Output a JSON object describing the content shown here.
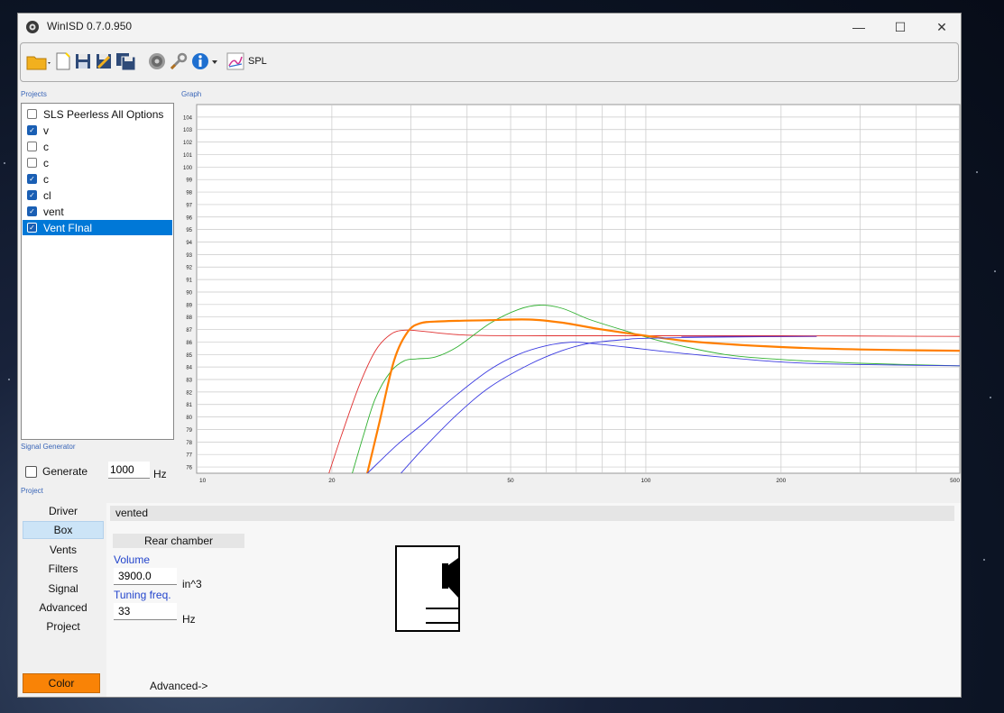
{
  "window": {
    "title": "WinISD 0.7.0.950"
  },
  "titlebar": {
    "minimize": "—",
    "maximize": "☐",
    "close": "✕"
  },
  "toolbar": {
    "spl_label": "SPL"
  },
  "groups": {
    "projects": "Projects",
    "graph": "Graph",
    "signal_generator": "Signal Generator",
    "project": "Project"
  },
  "projects": [
    {
      "name": "SLS Peerless All Options",
      "checked": false
    },
    {
      "name": "v",
      "checked": true
    },
    {
      "name": "c",
      "checked": false
    },
    {
      "name": "c",
      "checked": false
    },
    {
      "name": "c",
      "checked": true
    },
    {
      "name": "cl",
      "checked": true
    },
    {
      "name": "vent",
      "checked": true
    },
    {
      "name": "Vent FInal",
      "checked": true,
      "selected": true
    }
  ],
  "signal_generator": {
    "generate_label": "Generate",
    "frequency": "1000",
    "unit": "Hz"
  },
  "nav": [
    "Driver",
    "Box",
    "Vents",
    "Filters",
    "Signal",
    "Advanced",
    "Project"
  ],
  "nav_active": "Box",
  "color_button": {
    "label": "Color",
    "color": "#f98306"
  },
  "box": {
    "type": "vented",
    "rear_chamber": "Rear chamber",
    "volume_label": "Volume",
    "volume_value": "3900.0",
    "volume_unit": "in^3",
    "tuning_label": "Tuning freq.",
    "tuning_value": "33",
    "tuning_unit": "Hz",
    "advanced_label": "Advanced->"
  },
  "chart_data": {
    "type": "line",
    "x_scale": "log",
    "xlim": [
      10,
      500
    ],
    "ylim": [
      75.5,
      105
    ],
    "x_ticks": [
      10,
      20,
      50,
      100,
      200,
      500
    ],
    "y_ticks": [
      76,
      77,
      78,
      79,
      80,
      81,
      82,
      83,
      84,
      85,
      86,
      87,
      88,
      89,
      90,
      91,
      92,
      93,
      94,
      95,
      96,
      97,
      98,
      99,
      100,
      101,
      102,
      103,
      104
    ],
    "grid": true,
    "series": [
      {
        "color": "#e03030",
        "width": 0.9,
        "points": [
          [
            19.5,
            75
          ],
          [
            21,
            78.5
          ],
          [
            23,
            82.5
          ],
          [
            25,
            85.3
          ],
          [
            27,
            86.6
          ],
          [
            29,
            86.95
          ],
          [
            32,
            86.85
          ],
          [
            40,
            86.55
          ],
          [
            60,
            86.5
          ],
          [
            100,
            86.5
          ],
          [
            200,
            86.5
          ],
          [
            500,
            86.45
          ]
        ]
      },
      {
        "color": "#30b030",
        "width": 0.9,
        "points": [
          [
            22,
            75
          ],
          [
            23.5,
            78.5
          ],
          [
            25,
            81.5
          ],
          [
            27,
            83.6
          ],
          [
            29,
            84.5
          ],
          [
            31,
            84.65
          ],
          [
            34,
            84.8
          ],
          [
            38,
            85.6
          ],
          [
            45,
            87.5
          ],
          [
            52,
            88.6
          ],
          [
            58,
            88.95
          ],
          [
            65,
            88.7
          ],
          [
            75,
            87.8
          ],
          [
            90,
            86.9
          ],
          [
            110,
            86.0
          ],
          [
            150,
            85.0
          ],
          [
            200,
            84.6
          ],
          [
            300,
            84.3
          ],
          [
            500,
            84.1
          ]
        ]
      },
      {
        "color": "#ff7f00",
        "width": 2.2,
        "points": [
          [
            23.8,
            75
          ],
          [
            25.5,
            79.5
          ],
          [
            27.5,
            84.5
          ],
          [
            29.5,
            86.8
          ],
          [
            31.5,
            87.5
          ],
          [
            35,
            87.65
          ],
          [
            45,
            87.75
          ],
          [
            55,
            87.8
          ],
          [
            65,
            87.55
          ],
          [
            80,
            87.0
          ],
          [
            100,
            86.5
          ],
          [
            130,
            86.0
          ],
          [
            200,
            85.6
          ],
          [
            300,
            85.4
          ],
          [
            500,
            85.3
          ]
        ]
      },
      {
        "color": "#3a3ae0",
        "width": 0.9,
        "points": [
          [
            24,
            75.5
          ],
          [
            28,
            77.8
          ],
          [
            32,
            79.5
          ],
          [
            38,
            81.8
          ],
          [
            45,
            83.8
          ],
          [
            52,
            85.0
          ],
          [
            60,
            85.7
          ],
          [
            68,
            85.98
          ],
          [
            75,
            85.9
          ],
          [
            90,
            85.6
          ],
          [
            120,
            85.1
          ],
          [
            200,
            84.4
          ],
          [
            300,
            84.2
          ],
          [
            500,
            84.1
          ]
        ]
      },
      {
        "color": "#3a3ae0",
        "width": 0.9,
        "points": [
          [
            28.5,
            75.5
          ],
          [
            32,
            77.5
          ],
          [
            38,
            80.2
          ],
          [
            45,
            82.4
          ],
          [
            55,
            84.2
          ],
          [
            65,
            85.3
          ],
          [
            75,
            85.9
          ],
          [
            90,
            86.2
          ],
          [
            100,
            86.3
          ],
          [
            150,
            86.4
          ],
          [
            240,
            86.45
          ]
        ]
      },
      {
        "color": "#7a2aa0",
        "width": 0.9,
        "points": [
          [
            120,
            86.45
          ],
          [
            180,
            86.45
          ],
          [
            240,
            86.45
          ]
        ]
      }
    ]
  }
}
